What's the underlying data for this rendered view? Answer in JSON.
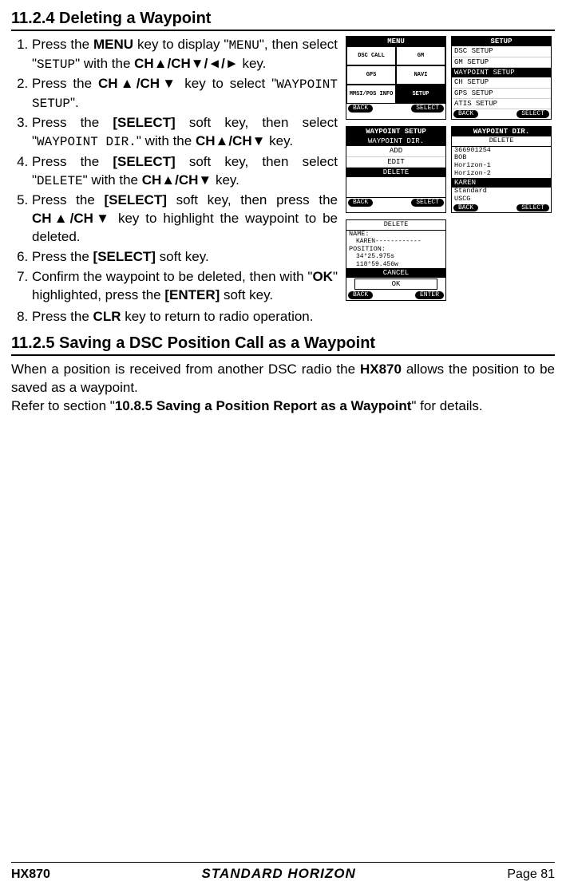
{
  "section1": {
    "title": "11.2.4  Deleting a Waypoint",
    "step1": {
      "pre": "Press the ",
      "b1": "MENU",
      "mid1": " key to display \"",
      "mono1": "MENU",
      "mid2": "\", then select \"",
      "mono2": "SETUP",
      "mid3": "\" with the ",
      "b2": "CH▲/CH▼/◄/►",
      "post": " key."
    },
    "step2": {
      "pre": "Press the ",
      "b1": "CH▲/CH▼",
      "mid1": " key to select \"",
      "mono1": "WAYPOINT SETUP",
      "post": "\"."
    },
    "step3": {
      "pre": "Press the ",
      "b1": "[SELECT]",
      "mid1": " soft key, then select \"",
      "mono1": "WAYPOINT DIR.",
      "mid2": "\" with the ",
      "b2": "CH▲/CH▼",
      "post": " key."
    },
    "step4": {
      "pre": "Press the ",
      "b1": "[SELECT]",
      "mid1": " soft key, then select \"",
      "mono1": "DELETE",
      "mid2": "\" with the ",
      "b2": "CH▲/CH▼",
      "post": " key."
    },
    "step5": {
      "pre": "Press the ",
      "b1": "[SELECT]",
      "mid1": " soft key, then press the ",
      "b2": "CH▲/CH▼",
      "post": " key to highlight the waypoint to be deleted."
    },
    "step6": {
      "pre": "Press the ",
      "b1": "[SELECT]",
      "post": " soft key."
    },
    "step7": {
      "pre": "Confirm the waypoint to be deleted, then with \"",
      "b1": "OK",
      "mid1": "\" highlighted, press the ",
      "b2": "[ENTER]",
      "post": " soft key."
    },
    "step8": {
      "pre": "Press the ",
      "b1": "CLR",
      "post": " key to return to radio operation."
    }
  },
  "section2": {
    "title": "11.2.5  Saving a DSC Position Call as a Waypoint",
    "p1_pre": "When a position is received from another DSC radio the ",
    "p1_b": "HX870",
    "p1_post": " allows the position to be saved as a waypoint.",
    "p2_pre": "Refer to section \"",
    "p2_b": "10.8.5  Saving a Position Report as a Waypoint",
    "p2_post": "\" for details."
  },
  "screens": {
    "menu": {
      "title": "MENU",
      "cells": [
        "DSC CALL",
        "GM",
        "GPS",
        "NAVI",
        "MMSI/POS INFO",
        "SETUP"
      ],
      "soft_l": "BACK",
      "soft_r": "SELECT"
    },
    "setup": {
      "title": "SETUP",
      "items": [
        "DSC SETUP",
        "GM SETUP",
        "WAYPOINT SETUP",
        "CH SETUP",
        "GPS SETUP",
        "ATIS SETUP"
      ],
      "sel_index": 2,
      "soft_l": "BACK",
      "soft_r": "SELECT"
    },
    "wpsetup": {
      "title": "WAYPOINT SETUP",
      "sub": "WAYPOINT DIR.",
      "items": [
        "ADD",
        "EDIT",
        "DELETE"
      ],
      "sel_index": 2,
      "soft_l": "BACK",
      "soft_r": "SELECT"
    },
    "wpdir": {
      "title": "WAYPOINT DIR.",
      "sub": "DELETE",
      "items": [
        "366901254",
        "BOB",
        "Horizon-1",
        "Horizon-2",
        "KAREN",
        "Standard",
        "USCG"
      ],
      "sel_index": 4,
      "soft_l": "BACK",
      "soft_r": "SELECT"
    },
    "delete": {
      "title": "DELETE",
      "name_label": "NAME:",
      "name_val": "KAREN------------",
      "pos_label": "POSITION:",
      "pos1": "34°25.975s",
      "pos2": "118°59.456w",
      "cancel": "CANCEL",
      "ok": "OK",
      "soft_l": "BACK",
      "soft_r": "ENTER"
    }
  },
  "footer": {
    "model": "HX870",
    "brand": "STANDARD HORIZON",
    "page": "Page 81"
  }
}
